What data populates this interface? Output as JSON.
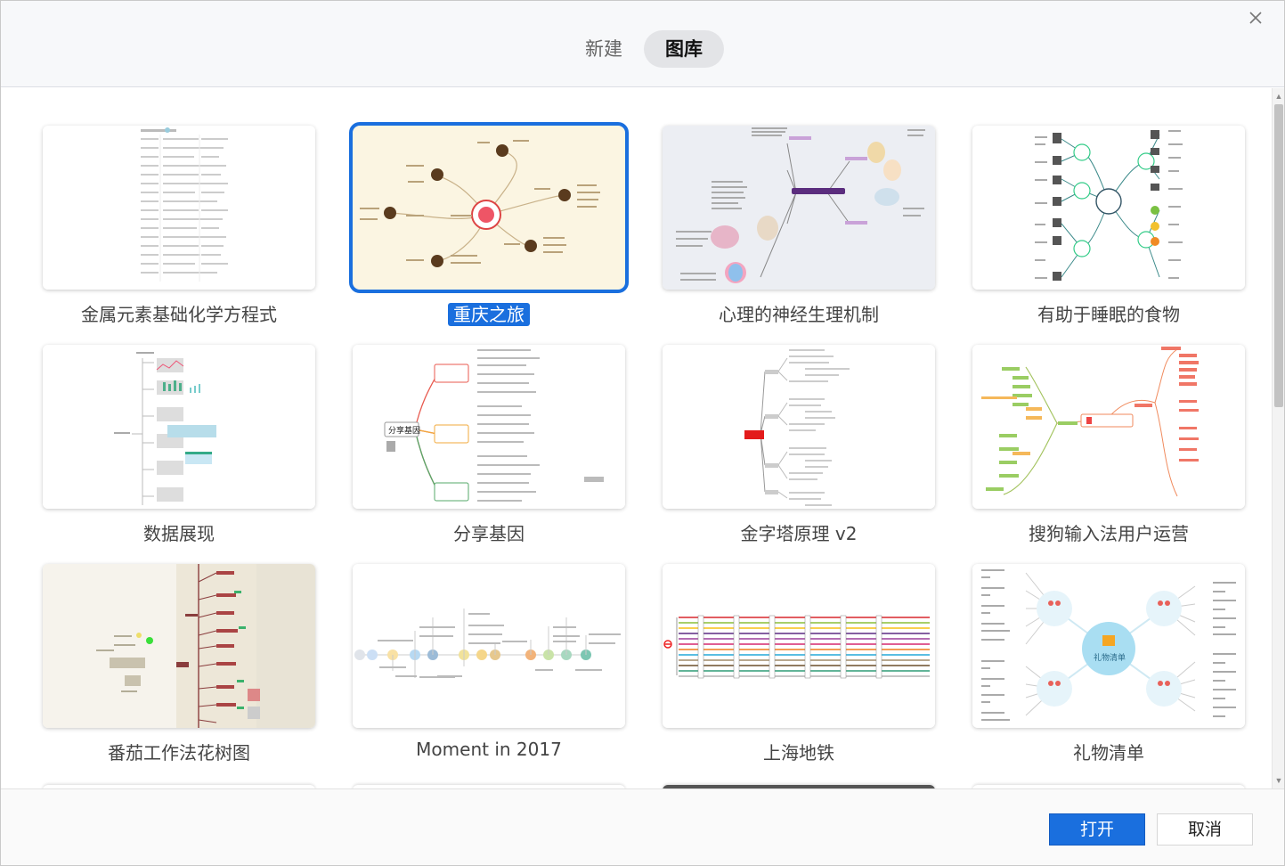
{
  "header": {
    "tabs": [
      {
        "label": "新建",
        "active": false
      },
      {
        "label": "图库",
        "active": true
      }
    ]
  },
  "gallery": {
    "items": [
      {
        "title": "金属元素基础化学方程式",
        "selected": false
      },
      {
        "title": "重庆之旅",
        "selected": true
      },
      {
        "title": "心理的神经生理机制",
        "selected": false
      },
      {
        "title": "有助于睡眠的食物",
        "selected": false
      },
      {
        "title": "数据展现",
        "selected": false
      },
      {
        "title": "分享基因",
        "selected": false
      },
      {
        "title": "金字塔原理 v2",
        "selected": false
      },
      {
        "title": "搜狗输入法用户运营",
        "selected": false
      },
      {
        "title": "番茄工作法花树图",
        "selected": false
      },
      {
        "title": "Moment in 2017",
        "selected": false
      },
      {
        "title": "上海地铁",
        "selected": false
      },
      {
        "title": "礼物清单",
        "selected": false
      }
    ],
    "thumb_texts": {
      "share_root": "分享基因",
      "gift_root": "礼物清单"
    }
  },
  "footer": {
    "open_label": "打开",
    "cancel_label": "取消"
  },
  "colors": {
    "accent": "#1a6fde",
    "header_bg": "#f7f8fa",
    "tab_active_bg": "#e3e4e7"
  }
}
